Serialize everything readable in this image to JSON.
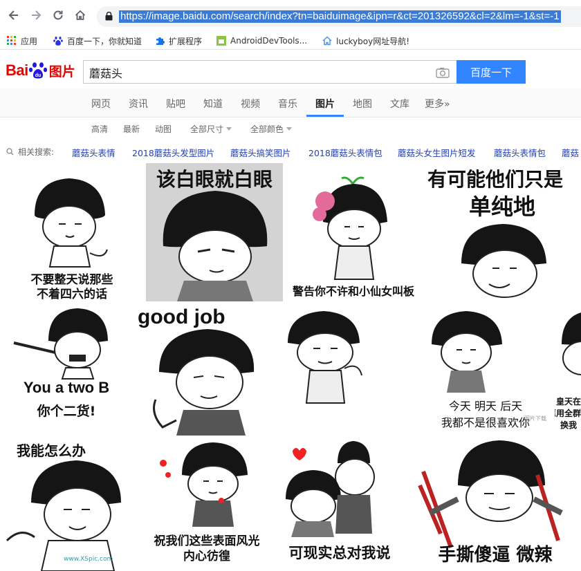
{
  "browser": {
    "url": "https://image.baidu.com/search/index?tn=baiduimage&ipn=r&ct=201326592&cl=2&lm=-1&st=-1",
    "nav": {
      "back_icon": "arrow-left-icon",
      "forward_icon": "arrow-right-icon",
      "reload_icon": "reload-icon",
      "home_icon": "home-icon"
    },
    "bookmarks": [
      {
        "label": "应用",
        "icon": "apps-grid-icon"
      },
      {
        "label": "百度一下，你就知道",
        "icon": "baidu-paw-icon"
      },
      {
        "label": "扩展程序",
        "icon": "puzzle-icon"
      },
      {
        "label": "AndroidDevTools...",
        "icon": "android-devtools-icon"
      },
      {
        "label": "luckyboy网址导航!",
        "icon": "home-outline-icon"
      }
    ]
  },
  "header": {
    "logo_bai": "Bai",
    "logo_du": "du",
    "logo_pic": "图片",
    "search_value": "蘑菇头",
    "search_button": "百度一下"
  },
  "tabs": [
    {
      "label": "网页"
    },
    {
      "label": "资讯"
    },
    {
      "label": "贴吧"
    },
    {
      "label": "知道"
    },
    {
      "label": "视频"
    },
    {
      "label": "音乐"
    },
    {
      "label": "图片",
      "active": true
    },
    {
      "label": "地图"
    },
    {
      "label": "文库"
    },
    {
      "label": "更多»"
    }
  ],
  "filters": [
    {
      "label": "高清"
    },
    {
      "label": "最新"
    },
    {
      "label": "动图"
    },
    {
      "label": "全部尺寸",
      "dropdown": true
    },
    {
      "label": "全部颜色",
      "dropdown": true
    }
  ],
  "related": {
    "label": "相关搜索:",
    "items": [
      "蘑菇头表情",
      "2018蘑菇头发型图片",
      "蘑菇头搞笑图片",
      "2018蘑菇头表情包",
      "蘑菇头女生图片短发",
      "蘑菇头表情包",
      "蘑菇"
    ]
  },
  "images": [
    {
      "captions": [
        "不要整天说那些",
        "不着四六的话"
      ]
    },
    {
      "captions": [
        "该白眼就白眼"
      ]
    },
    {
      "captions": [
        "警告你不许和小仙女叫板"
      ]
    },
    {
      "captions": [
        "有可能他们只是",
        "单纯地"
      ]
    },
    {
      "captions": [
        "good job"
      ]
    },
    {
      "captions": [
        "You a two B",
        "你个二货!"
      ]
    },
    {
      "captions": []
    },
    {
      "captions": [
        "今天 明天 后天",
        "我都不是很喜欢你"
      ],
      "watermark": "图片下载"
    },
    {
      "captions": [
        "皇天在",
        "我愿用全群",
        "换我"
      ]
    },
    {
      "captions": [
        "我能怎么办"
      ],
      "watermark": "www.XSpic.com"
    },
    {
      "captions": [
        "祝我们这些表面风光",
        "内心彷徨"
      ]
    },
    {
      "captions": [
        "可现实总对我说"
      ]
    },
    {
      "captions": [
        "手撕傻逼 微辣"
      ]
    }
  ],
  "colors": {
    "accent": "#3385ff",
    "link": "#2440b3",
    "brand_red": "#e10601",
    "brand_blue": "#2319dc"
  }
}
